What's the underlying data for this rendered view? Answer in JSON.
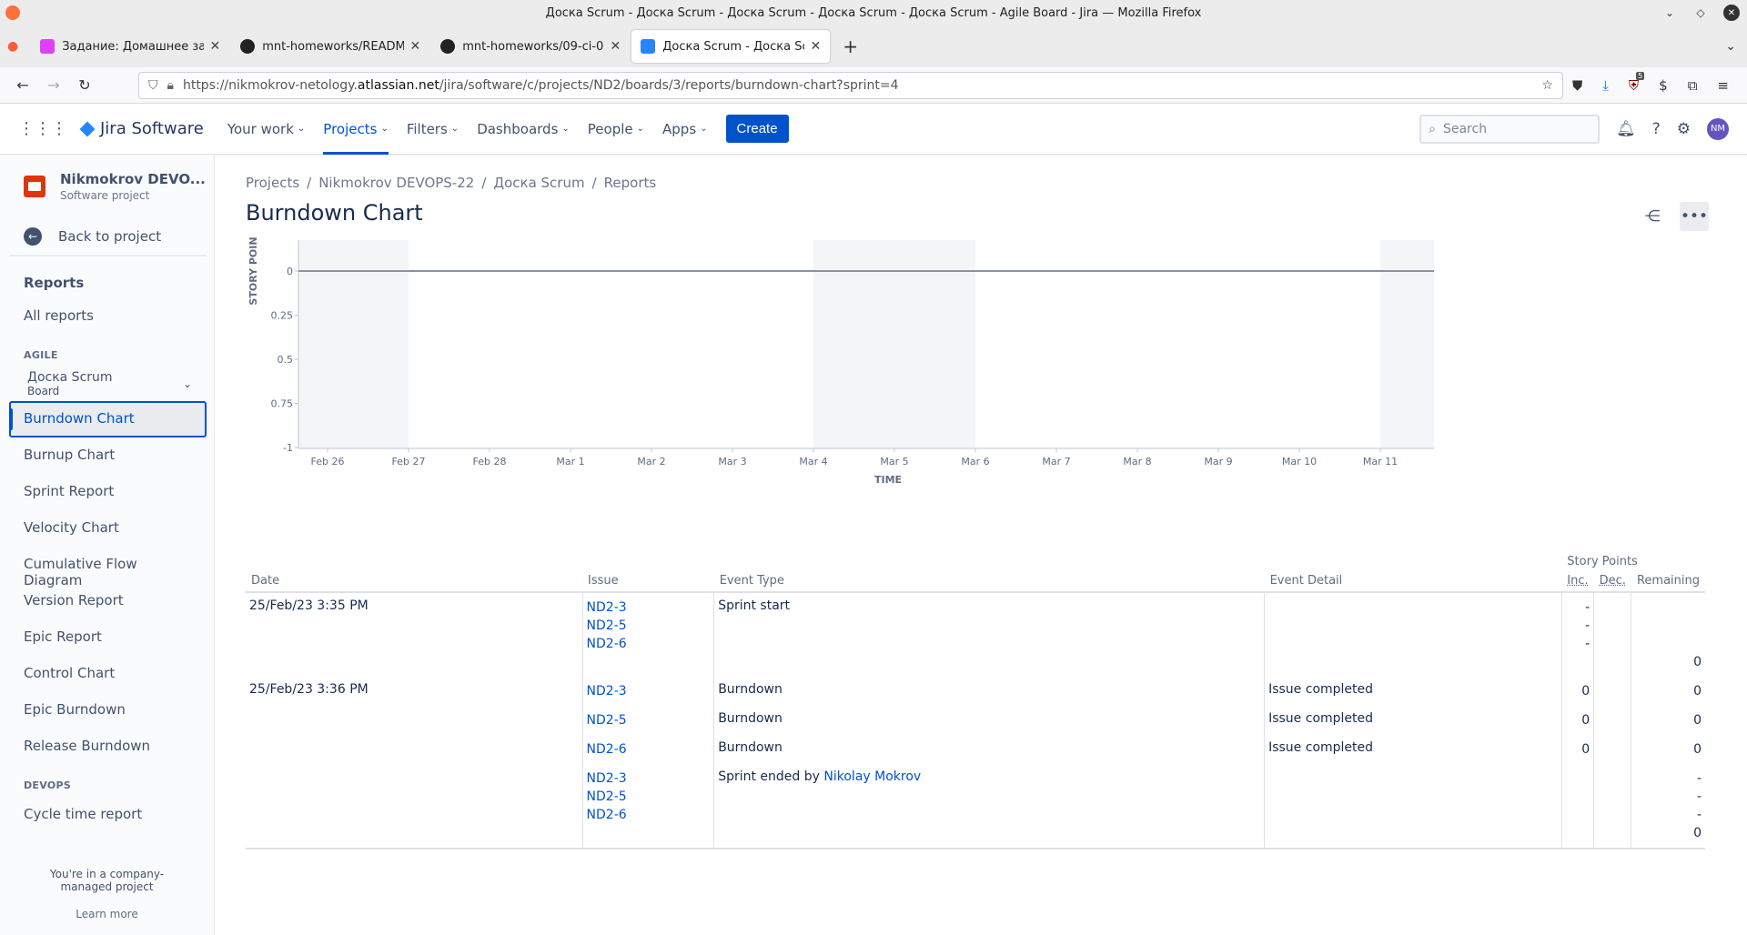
{
  "window": {
    "title": "Доска Scrum - Доска Scrum - Доска Scrum - Доска Scrum - Доска Scrum - Agile Board - Jira — Mozilla Firefox"
  },
  "browser": {
    "tabs": [
      {
        "title": "Задание: Домашнее задание",
        "icon": "netology-icon",
        "active": false
      },
      {
        "title": "mnt-homeworks/README.md",
        "icon": "github-icon",
        "active": false
      },
      {
        "title": "mnt-homeworks/09-ci-01-intro",
        "icon": "github-icon",
        "active": false
      },
      {
        "title": "Доска Scrum - Доска Scrum",
        "icon": "jira-icon",
        "active": true
      }
    ],
    "url_prefix": "https://nikmokrov-netology.",
    "url_domain": "atlassian.net",
    "url_path": "/jira/software/c/projects/ND2/boards/3/reports/burndown-chart?sprint=4",
    "ext_badge": "5"
  },
  "jira_nav": {
    "product": "Jira Software",
    "items": [
      "Your work",
      "Projects",
      "Filters",
      "Dashboards",
      "People",
      "Apps"
    ],
    "selected": "Projects",
    "create": "Create",
    "search_placeholder": "Search",
    "avatar": "NM"
  },
  "sidebar": {
    "project_name": "Nikmokrov DEVO...",
    "project_type": "Software project",
    "back": "Back to project",
    "reports_title": "Reports",
    "all_reports": "All reports",
    "agile_label": "AGILE",
    "board_name": "Доска Scrum",
    "board_sub": "Board",
    "items": [
      "Burndown Chart",
      "Burnup Chart",
      "Sprint Report",
      "Velocity Chart",
      "Cumulative Flow Diagram",
      "Version Report",
      "Epic Report",
      "Control Chart",
      "Epic Burndown",
      "Release Burndown"
    ],
    "selected": "Burndown Chart",
    "devops_label": "DEVOPS",
    "devops_item": "Cycle time report",
    "footer": "You're in a company-managed project",
    "learn_more": "Learn more"
  },
  "breadcrumbs": [
    "Projects",
    "Nikmokrov DEVOPS-22",
    "Доска Scrum",
    "Reports"
  ],
  "page_title": "Burndown Chart",
  "chart_data": {
    "type": "line",
    "ylabel": "STORY POIN",
    "xlabel": "TIME",
    "y_ticks": [
      "0",
      "0.25",
      "0.5",
      "0.75",
      "-1"
    ],
    "x_ticks": [
      "Feb 26",
      "Feb 27",
      "Feb 28",
      "Mar 1",
      "Mar 2",
      "Mar 3",
      "Mar 4",
      "Mar 5",
      "Mar 6",
      "Mar 7",
      "Mar 8",
      "Mar 9",
      "Mar 10",
      "Mar 11"
    ],
    "series": [
      {
        "values": [
          0,
          0,
          0,
          0,
          0,
          0,
          0,
          0,
          0,
          0,
          0,
          0,
          0,
          0
        ]
      }
    ],
    "nonworking_spans": [
      [
        "Feb 26",
        "Feb 27"
      ],
      [
        "Mar 4",
        "Mar 6"
      ],
      [
        "Mar 11",
        "Mar 11"
      ]
    ],
    "colors": {
      "nonworking": "#f4f5f7",
      "line": "#8993a4"
    }
  },
  "table": {
    "story_points_label": "Story Points",
    "headers": {
      "date": "Date",
      "issue": "Issue",
      "event_type": "Event Type",
      "event_detail": "Event Detail",
      "inc": "Inc.",
      "dec": "Dec.",
      "remaining": "Remaining"
    },
    "rows": [
      {
        "date": "25/Feb/23 3:35 PM",
        "issues": [
          "ND2-3",
          "ND2-5",
          "ND2-6"
        ],
        "event": "Sprint start",
        "event_link": "",
        "detail": "",
        "inc": [
          "-",
          "-",
          "-"
        ],
        "dec": [],
        "remaining": [
          "",
          "",
          "",
          "0"
        ]
      },
      {
        "date": "25/Feb/23 3:36 PM",
        "issues": [
          "ND2-3"
        ],
        "event": "Burndown",
        "event_link": "",
        "detail": "Issue completed",
        "inc": [
          "0"
        ],
        "dec": [],
        "remaining": [
          "0"
        ]
      },
      {
        "date": "",
        "issues": [
          "ND2-5"
        ],
        "event": "Burndown",
        "event_link": "",
        "detail": "Issue completed",
        "inc": [
          "0"
        ],
        "dec": [],
        "remaining": [
          "0"
        ]
      },
      {
        "date": "",
        "issues": [
          "ND2-6"
        ],
        "event": "Burndown",
        "event_link": "",
        "detail": "Issue completed",
        "inc": [
          "0"
        ],
        "dec": [],
        "remaining": [
          "0"
        ]
      },
      {
        "date": "",
        "issues": [
          "ND2-3",
          "ND2-5",
          "ND2-6"
        ],
        "event": "Sprint ended by ",
        "event_link": "Nikolay Mokrov",
        "detail": "",
        "inc": [],
        "dec": [],
        "remaining": [
          "-",
          "-",
          "-",
          "0"
        ]
      }
    ]
  }
}
